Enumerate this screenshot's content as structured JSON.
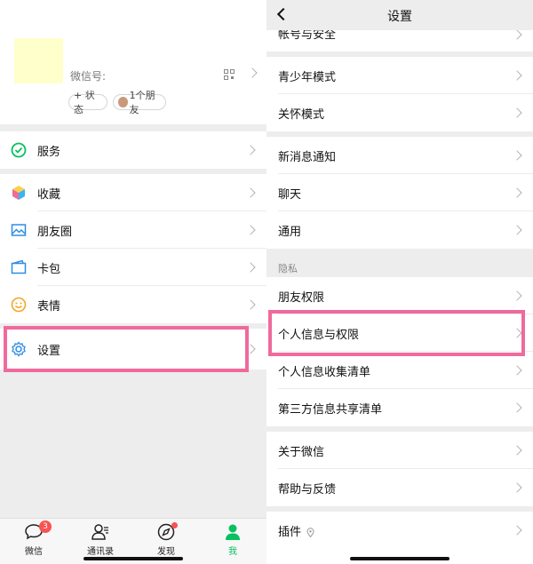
{
  "me": {
    "profile": {
      "wechat_id_label": "微信号:",
      "status_button": "+ 状态",
      "friends_button": "1个朋友"
    },
    "menu": {
      "services": "服务",
      "favorites": "收藏",
      "moments": "朋友圈",
      "cards": "卡包",
      "stickers": "表情",
      "settings": "设置"
    },
    "tabbar": {
      "chats": "微信",
      "chats_badge": "3",
      "contacts": "通讯录",
      "discover": "发现",
      "me": "我"
    }
  },
  "settings": {
    "title": "设置",
    "account_security": "帐号与安全",
    "teen_mode": "青少年模式",
    "care_mode": "关怀模式",
    "new_message_notify": "新消息通知",
    "chat": "聊天",
    "general": "通用",
    "privacy_section": "隐私",
    "friend_permissions": "朋友权限",
    "personal_info_permissions": "个人信息与权限",
    "personal_info_list": "个人信息收集清单",
    "third_party_list": "第三方信息共享清单",
    "about": "关于微信",
    "help_feedback": "帮助与反馈",
    "plugins": "插件"
  },
  "colors": {
    "wechat_green": "#07c160",
    "highlight_pink": "#f06a9b",
    "badge_red": "#fa5151"
  }
}
